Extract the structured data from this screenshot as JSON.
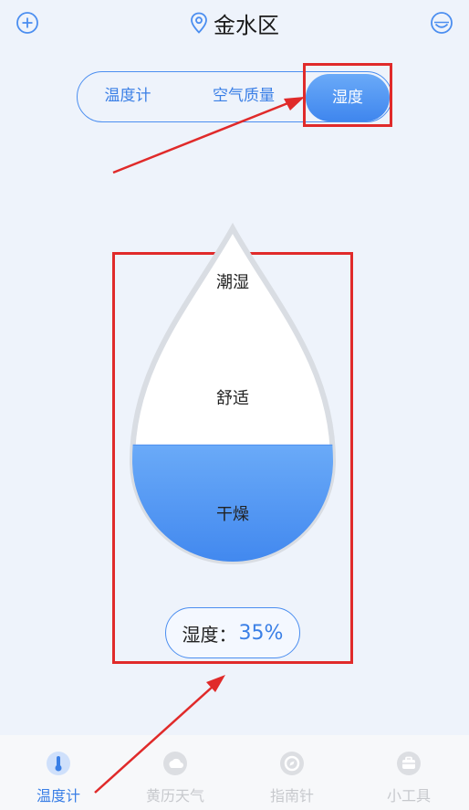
{
  "header": {
    "add_icon": "plus-circle-icon",
    "location_icon": "map-pin-icon",
    "location": "金水区",
    "profile_icon": "face-icon"
  },
  "segments": [
    {
      "label": "温度计",
      "active": false
    },
    {
      "label": "空气质量",
      "active": false
    },
    {
      "label": "湿度",
      "active": true
    }
  ],
  "gauge": {
    "levels": [
      "潮湿",
      "舒适",
      "干燥"
    ],
    "fill_fraction": 0.35
  },
  "readout": {
    "label": "湿度：",
    "value": "35%"
  },
  "tabs": [
    {
      "label": "温度计",
      "icon": "thermometer-icon",
      "active": true
    },
    {
      "label": "黄历天气",
      "icon": "calendar-weather-icon",
      "active": false
    },
    {
      "label": "指南针",
      "icon": "compass-icon",
      "active": false
    },
    {
      "label": "小工具",
      "icon": "toolbox-icon",
      "active": false
    }
  ],
  "colors": {
    "accent": "#3a7fe6",
    "fill_top": "#6aaaf8",
    "fill_bottom": "#3f86ee",
    "annotation": "#e02a2a",
    "background": "#eef3fb"
  }
}
